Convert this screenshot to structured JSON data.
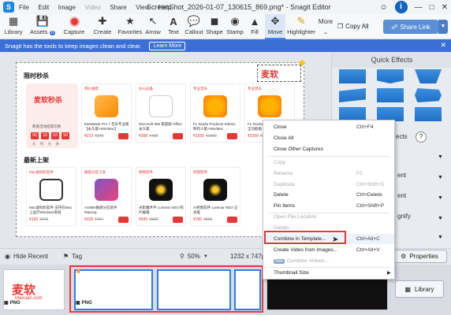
{
  "window": {
    "title": "ScreenShot_2026-01-07_130615_869.png* - Snagit Editor",
    "menu": [
      "File",
      "Edit",
      "Image",
      "Video",
      "Share",
      "View",
      "Help"
    ]
  },
  "toolbar": {
    "library": "Library",
    "assets": "Assets",
    "assets_count": "0",
    "capture": "Capture",
    "create": "Create",
    "tools": [
      "Favorites",
      "Arrow",
      "Text",
      "Callout",
      "Shape",
      "Stamp",
      "Fill",
      "Move",
      "Highlighter"
    ],
    "more": "More",
    "copy_all": "Copy All",
    "share_link": "Share Link"
  },
  "notification": {
    "text": "Snagit has the tools to keep images clean and clear.",
    "learn_more": "Learn More"
  },
  "canvas": {
    "section1_title": "限时秒杀",
    "section2_title": "最新上架",
    "promo_title": "麦软秒杀",
    "promo_sub": "距离活动结束仅剩",
    "countdown": [
      "00",
      "15",
      "53",
      "50"
    ],
    "countdown_labels": "天时分秒",
    "logo_text": "麦软",
    "row1": [
      {
        "tag": "特价推荐",
        "name": "EarMaster Pro 7 音乐专业版【永久版+Win/Mac】",
        "price": "¥219",
        "old": "¥279"
      },
      {
        "tag": "办公必备",
        "name": "Microsoft 365 家庭版 Office 永久版",
        "price": "¥398",
        "old": "¥498"
      },
      {
        "tag": "专业音乐",
        "name": "FL Studio Producer Edition 制作人版+Win/Mac",
        "price": "¥1599",
        "old": "¥1999"
      },
      {
        "tag": "专业音乐",
        "name": "FL Studio Producer Edition 全功能版+Win/Mac",
        "price": "¥2399",
        "old": "¥2999"
      }
    ],
    "row2": [
      {
        "tag": "Mac虚拟机软件",
        "name": "Mac虚拟机软件 支持在Mac上运行Windows系统",
        "price": "¥199",
        "old": "¥249"
      },
      {
        "tag": "磁盘分区工具",
        "name": "AOMEI磁盘分区助手 iMazing",
        "price": "¥328",
        "old": "¥457"
      },
      {
        "tag": "修图软件",
        "name": "光影魔术手 Luminar NEO 照片编辑",
        "price": "¥599",
        "old": "¥899"
      },
      {
        "tag": "修图软件",
        "name": "AI修图软件 Luminar NEO 正式版",
        "price": "¥780",
        "old": "¥899"
      }
    ]
  },
  "right_panel": {
    "title": "Quick Effects",
    "effects_label": "ects",
    "help": "?",
    "side_labels": [
      "ent",
      "ent",
      "gnify"
    ]
  },
  "context_menu": {
    "items": [
      {
        "label": "Close",
        "key": "Ctrl+F4",
        "disabled": false
      },
      {
        "label": "Close All",
        "key": "",
        "disabled": false
      },
      {
        "label": "Close Other Captures",
        "key": "",
        "disabled": false
      },
      {
        "label": "Copy",
        "key": "",
        "disabled": true
      },
      {
        "label": "Rename",
        "key": "F2",
        "disabled": true
      },
      {
        "label": "Duplicate",
        "key": "Ctrl+Shift+D",
        "disabled": true
      },
      {
        "label": "Delete",
        "key": "Ctrl+Delete",
        "disabled": false
      },
      {
        "label": "Pin Items",
        "key": "Ctrl+Shift+P",
        "disabled": false
      },
      {
        "label": "Open File Location",
        "key": "",
        "disabled": true
      },
      {
        "label": "Details",
        "key": "",
        "disabled": true
      },
      {
        "label": "Combine in Template...",
        "key": "Ctrl+Alt+C",
        "disabled": false
      },
      {
        "label": "Create Video from Images...",
        "key": "Ctrl+Alt+V",
        "disabled": false
      },
      {
        "label": "Combine Videos...",
        "key": "",
        "disabled": true,
        "badge": "New"
      },
      {
        "label": "Thumbnail Size",
        "key": "",
        "disabled": false,
        "submenu": true
      }
    ]
  },
  "bottom_bar": {
    "hide_recent": "Hide Recent",
    "tag": "Tag",
    "zoom": "50%",
    "dimensions": "1232 x 747px",
    "properties": "Properties"
  },
  "tray": {
    "thumb_labels": [
      "PNG",
      "PNG"
    ],
    "logo_text": "麦软",
    "logo_sub": "Mairuan.com",
    "library": "Library"
  },
  "colors": {
    "accent": "#3b6fd4",
    "highlight_red": "#e53935",
    "share_link": "#5b8fd6"
  }
}
